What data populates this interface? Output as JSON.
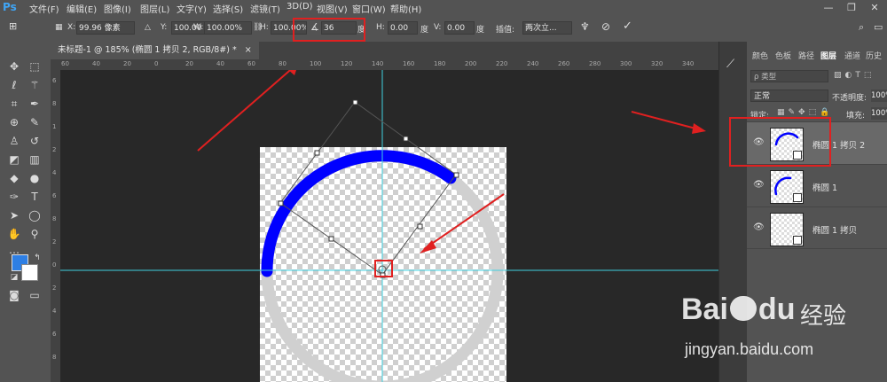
{
  "app": {
    "logo": "Ps"
  },
  "menu": [
    "文件(F)",
    "编辑(E)",
    "图像(I)",
    "图层(L)",
    "文字(Y)",
    "选择(S)",
    "滤镜(T)",
    "3D(D)",
    "视图(V)",
    "窗口(W)",
    "帮助(H)"
  ],
  "window_controls": {
    "minimize": "—",
    "maximize": "❐",
    "close": "✕"
  },
  "options": {
    "x_label": "X:",
    "x_value": "99.96 像素",
    "y_label": "Y:",
    "y_value": "100.00 像",
    "w_label": "W:",
    "w_value": "100.00%",
    "h_label": "H:",
    "h_value": "100.00%",
    "angle_value": "36",
    "angle_unit": "度",
    "hskew_label": "H:",
    "hskew_value": "0.00",
    "hskew_unit": "度",
    "vskew_label": "V:",
    "vskew_value": "0.00",
    "vskew_unit": "度",
    "interp_label": "插值:",
    "interp_value": "两次立..."
  },
  "document_tab": {
    "title": "未标题-1 @ 185% (椭圆 1 拷贝 2, RGB/8#) *",
    "close": "×"
  },
  "ruler_top": [
    "60",
    "40",
    "20",
    "0",
    "20",
    "40",
    "60",
    "80",
    "100",
    "120",
    "140",
    "160",
    "180",
    "200",
    "220",
    "240",
    "260",
    "280",
    "300",
    "320",
    "340"
  ],
  "ruler_left": [
    "6",
    "8",
    "1",
    "2",
    "4",
    "6",
    "8",
    "2",
    "0",
    "2",
    "4",
    "6",
    "8"
  ],
  "layers_panel": {
    "tabs": [
      "颜色",
      "色板",
      "路径",
      "图层",
      "通道",
      "历史"
    ],
    "active_tab": "图层",
    "filter_placeholder": "ρ 类型",
    "blend_mode": "正常",
    "opacity_label": "不透明度:",
    "opacity_value": "100%",
    "lock_label": "锁定:",
    "fill_label": "填充:",
    "fill_value": "100%",
    "layers": [
      {
        "name": "椭圆 1 拷贝 2",
        "selected": true
      },
      {
        "name": "椭圆 1",
        "selected": false
      },
      {
        "name": "椭圆 1 拷贝",
        "selected": false
      }
    ]
  },
  "colors": {
    "foreground": "#2e7fe4",
    "background": "#ffffff",
    "arc_blue": "#0000ff",
    "arc_gray": "#d0d0d0",
    "guide": "#3fd0e0",
    "annotation_red": "#e02020"
  },
  "watermark": {
    "brand_left": "Bai",
    "brand_right": "du",
    "brand_cn": "经验",
    "url": "jingyan.baidu.com"
  }
}
